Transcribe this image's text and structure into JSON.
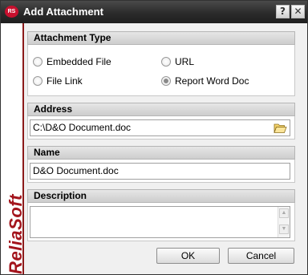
{
  "window": {
    "title": "Add Attachment",
    "logo_text": "RS",
    "help_glyph": "?",
    "close_glyph": "✕",
    "brand_text": "ReliaSoft",
    "accent_color": "#a3141c"
  },
  "attachment_type": {
    "header": "Attachment Type",
    "options": [
      {
        "label": "Embedded File",
        "checked": false
      },
      {
        "label": "URL",
        "checked": false
      },
      {
        "label": "File Link",
        "checked": false
      },
      {
        "label": "Report Word Doc",
        "checked": true
      }
    ]
  },
  "address": {
    "header": "Address",
    "value": "C:\\D&O Document.doc",
    "browse_icon": "folder-open-icon"
  },
  "name": {
    "header": "Name",
    "value": "D&O Document.doc"
  },
  "description": {
    "header": "Description",
    "value": ""
  },
  "buttons": {
    "ok": "OK",
    "cancel": "Cancel"
  }
}
